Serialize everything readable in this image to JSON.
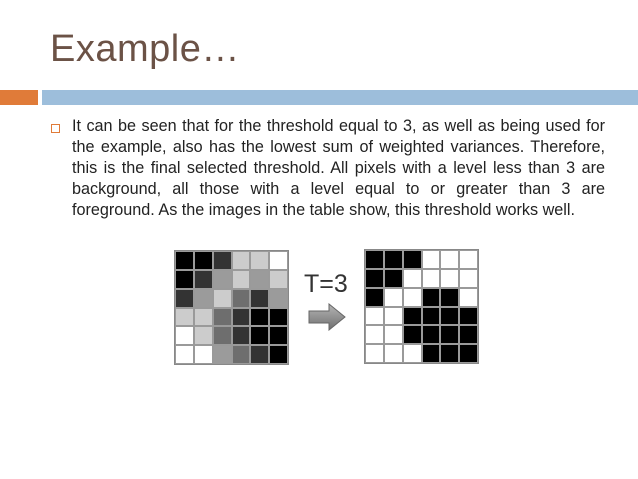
{
  "slide": {
    "title": "Example…",
    "body_text": "It can be seen that for the threshold equal to 3, as well as being used for the example, also has the lowest sum of weighted variances. Therefore, this is the final selected threshold. All pixels with a level less than 3 are background, all those with a level equal to or greater than 3 are foreground. As the images in the table show, this threshold works well.",
    "threshold_label": "T=3"
  },
  "colors": {
    "title": "#6b5246",
    "accent_orange": "#e07b39",
    "accent_blue": "#9dbedb"
  },
  "grayscale_image": {
    "levels": [
      [
        0,
        0,
        1,
        4,
        4,
        5
      ],
      [
        0,
        1,
        3,
        4,
        3,
        4
      ],
      [
        1,
        3,
        4,
        2,
        1,
        3
      ],
      [
        4,
        4,
        2,
        1,
        0,
        0
      ],
      [
        5,
        4,
        2,
        1,
        0,
        0
      ],
      [
        5,
        5,
        3,
        2,
        1,
        0
      ]
    ],
    "palette": [
      "#000000",
      "#333333",
      "#6e6e6e",
      "#9b9b9b",
      "#cccccc",
      "#ffffff"
    ]
  },
  "thresholded_image": {
    "pixels": [
      [
        1,
        1,
        1,
        0,
        0,
        0
      ],
      [
        1,
        1,
        0,
        0,
        0,
        0
      ],
      [
        1,
        0,
        0,
        1,
        1,
        0
      ],
      [
        0,
        0,
        1,
        1,
        1,
        1
      ],
      [
        0,
        0,
        1,
        1,
        1,
        1
      ],
      [
        0,
        0,
        0,
        1,
        1,
        1
      ]
    ],
    "on_color": "#000000",
    "off_color": "#ffffff"
  }
}
